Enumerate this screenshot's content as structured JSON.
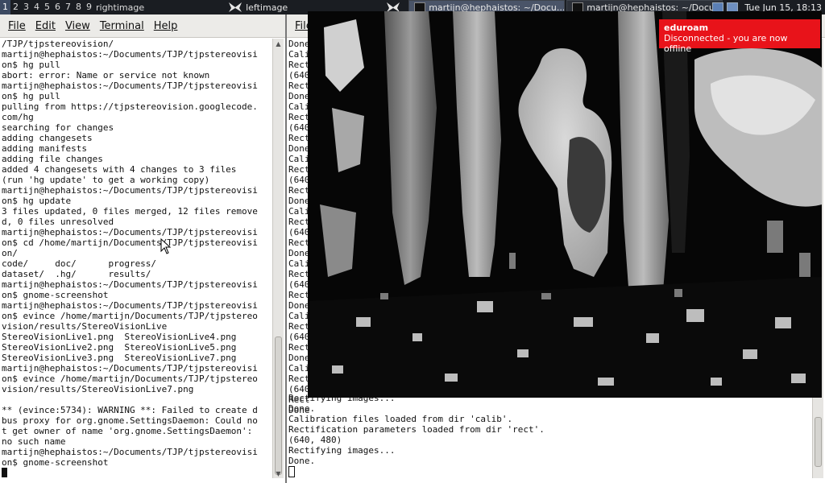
{
  "panel": {
    "workspaces": [
      "1",
      "2",
      "3",
      "4",
      "5",
      "6",
      "7",
      "8",
      "9"
    ],
    "active_workspace": "1",
    "workspace_name": "rightimage",
    "tasks": [
      {
        "label": "leftimage",
        "icon": "butterfly-icon"
      },
      {
        "label": "martijn@hephaistos: ~/Docu...",
        "icon": "terminal-icon"
      },
      {
        "label": "martijn@hephaistos: ~/Docu...",
        "icon": "terminal-icon"
      }
    ],
    "clock": "Tue Jun 15, 18:13"
  },
  "left_terminal": {
    "menu": [
      "File",
      "Edit",
      "View",
      "Terminal",
      "Help"
    ],
    "lines": [
      "/TJP/tjpstereovision/",
      "martijn@hephaistos:~/Documents/TJP/tjpstereovisi",
      "on$ hg pull",
      "abort: error: Name or service not known",
      "martijn@hephaistos:~/Documents/TJP/tjpstereovisi",
      "on$ hg pull",
      "pulling from https://tjpstereovision.googlecode.",
      "com/hg",
      "searching for changes",
      "adding changesets",
      "adding manifests",
      "adding file changes",
      "added 4 changesets with 4 changes to 3 files",
      "(run 'hg update' to get a working copy)",
      "martijn@hephaistos:~/Documents/TJP/tjpstereovisi",
      "on$ hg update",
      "3 files updated, 0 files merged, 12 files remove",
      "d, 0 files unresolved",
      "martijn@hephaistos:~/Documents/TJP/tjpstereovisi",
      "on$ cd /home/martijn/Documents/TJP/tjpstereovisi",
      "on/",
      "code/     doc/      progress/",
      "dataset/  .hg/      results/",
      "martijn@hephaistos:~/Documents/TJP/tjpstereovisi",
      "on$ gnome-screenshot",
      "martijn@hephaistos:~/Documents/TJP/tjpstereovisi",
      "on$ evince /home/martijn/Documents/TJP/tjpstereo",
      "vision/results/StereoVisionLive",
      "StereoVisionLive1.png  StereoVisionLive4.png",
      "StereoVisionLive2.png  StereoVisionLive5.png",
      "StereoVisionLive3.png  StereoVisionLive7.png",
      "martijn@hephaistos:~/Documents/TJP/tjpstereovisi",
      "on$ evince /home/martijn/Documents/TJP/tjpstereo",
      "vision/results/StereoVisionLive7.png",
      "",
      "** (evince:5734): WARNING **: Failed to create d",
      "bus proxy for org.gnome.SettingsDaemon: Could no",
      "t get owner of name 'org.gnome.SettingsDaemon':",
      "no such name",
      "martijn@hephaistos:~/Documents/TJP/tjpstereovisi",
      "on$ gnome-screenshot"
    ]
  },
  "right_terminal": {
    "menu_first": "File",
    "side_lines": [
      "Done",
      "Cali",
      "Rect",
      "(640",
      "Rect",
      "Done",
      "Cali",
      "Rect",
      "(640",
      "Rect",
      "Done",
      "Cali",
      "Rect",
      "(640",
      "Rect",
      "Done",
      "Cali",
      "Rect",
      "(640",
      "Rect",
      "Done",
      "Cali",
      "Rect",
      "(640",
      "Rect",
      "Done",
      "Cali",
      "Rect",
      "(640",
      "Rect",
      "Done",
      "Cali",
      "Rect",
      "(640",
      "Rect",
      "Done"
    ],
    "bottom_lines": [
      "Rectifying images...",
      "Done.",
      "Calibration files loaded from dir 'calib'.",
      "Rectification parameters loaded from dir 'rect'.",
      "(640, 480)",
      "Rectifying images...",
      "Done."
    ]
  },
  "notification": {
    "title": "eduroam",
    "message": "Disconnected - you are now offline",
    "color": "#e8131a"
  }
}
